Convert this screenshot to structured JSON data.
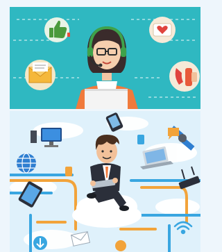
{
  "images": [
    {
      "name": "customer-support-illustration"
    },
    {
      "name": "cloud-network-illustration"
    }
  ],
  "colors": {
    "support_bg": "#2fb8c1",
    "network_bg": "#dff1fb",
    "cloud": "#ffffff",
    "line_blue": "#39a6e0",
    "line_orange": "#f2a33a",
    "suit": "#2b2f3a",
    "shirt_orange": "#f07a3c"
  }
}
